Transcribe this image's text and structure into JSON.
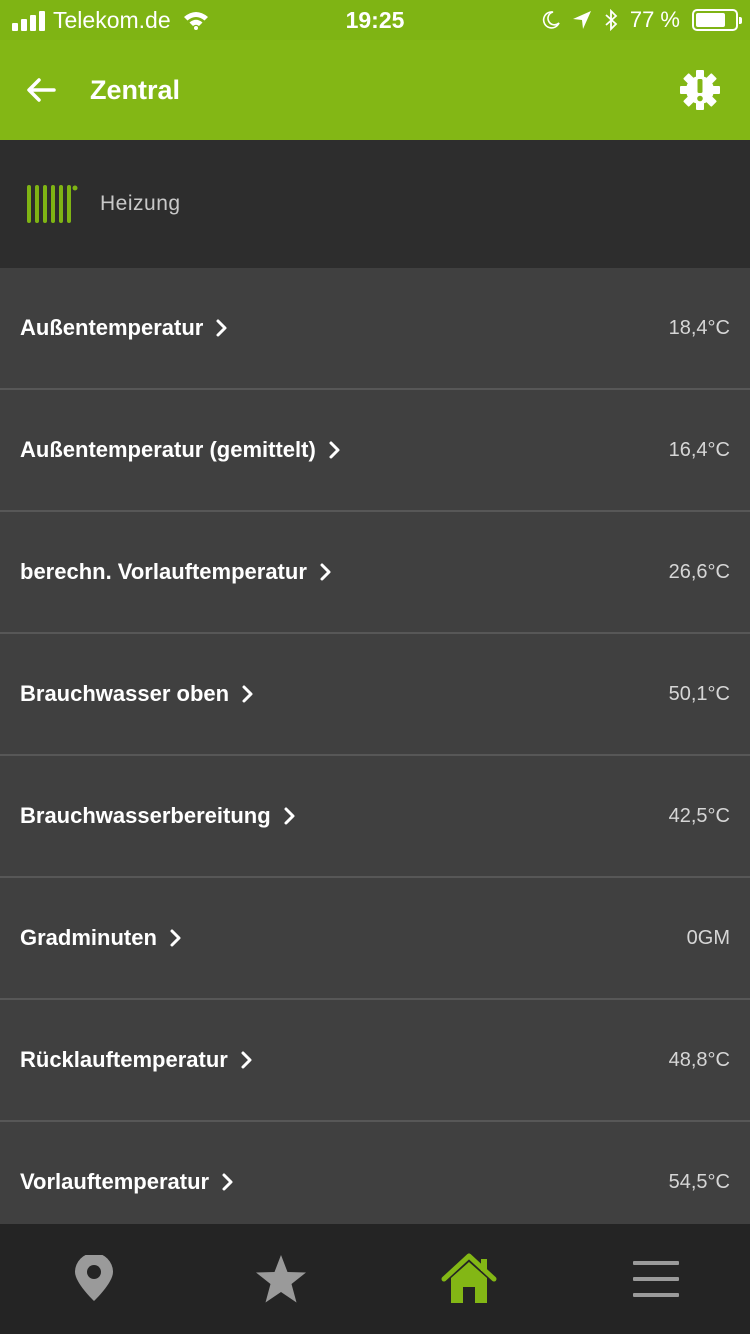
{
  "status_bar": {
    "carrier": "Telekom.de",
    "time": "19:25",
    "battery_percent": "77 %",
    "battery_level": 0.77,
    "icons": [
      "signal-icon",
      "wifi-icon",
      "moon-icon",
      "location-arrow-icon",
      "bluetooth-icon",
      "battery-icon"
    ]
  },
  "app_bar": {
    "title": "Zentral",
    "back_icon": "arrow-left-icon",
    "settings_icon": "gear-alert-icon"
  },
  "section": {
    "icon": "radiator-icon",
    "title": "Heizung"
  },
  "list": {
    "items": [
      {
        "label": "Außentemperatur",
        "value": "18,4°C"
      },
      {
        "label": "Außentemperatur (gemittelt)",
        "value": "16,4°C"
      },
      {
        "label": "berechn. Vorlauftemperatur",
        "value": "26,6°C"
      },
      {
        "label": "Brauchwasser oben",
        "value": "50,1°C"
      },
      {
        "label": "Brauchwasserbereitung",
        "value": "42,5°C"
      },
      {
        "label": "Gradminuten",
        "value": "0GM"
      },
      {
        "label": "Rücklauftemperatur",
        "value": "48,8°C"
      },
      {
        "label": "Vorlauftemperatur",
        "value": "54,5°C"
      }
    ]
  },
  "bottom_nav": {
    "tabs": [
      {
        "icon": "map-pin-icon",
        "active": false
      },
      {
        "icon": "star-icon",
        "active": false
      },
      {
        "icon": "home-icon",
        "active": true
      },
      {
        "icon": "menu-icon",
        "active": false
      }
    ]
  },
  "colors": {
    "accent_green": "#83b715",
    "status_bar_green": "#7fb414",
    "list_background": "#404040",
    "header_background": "#2d2d2d",
    "nav_background": "#242424",
    "inactive_icon": "#9a9a9a"
  }
}
